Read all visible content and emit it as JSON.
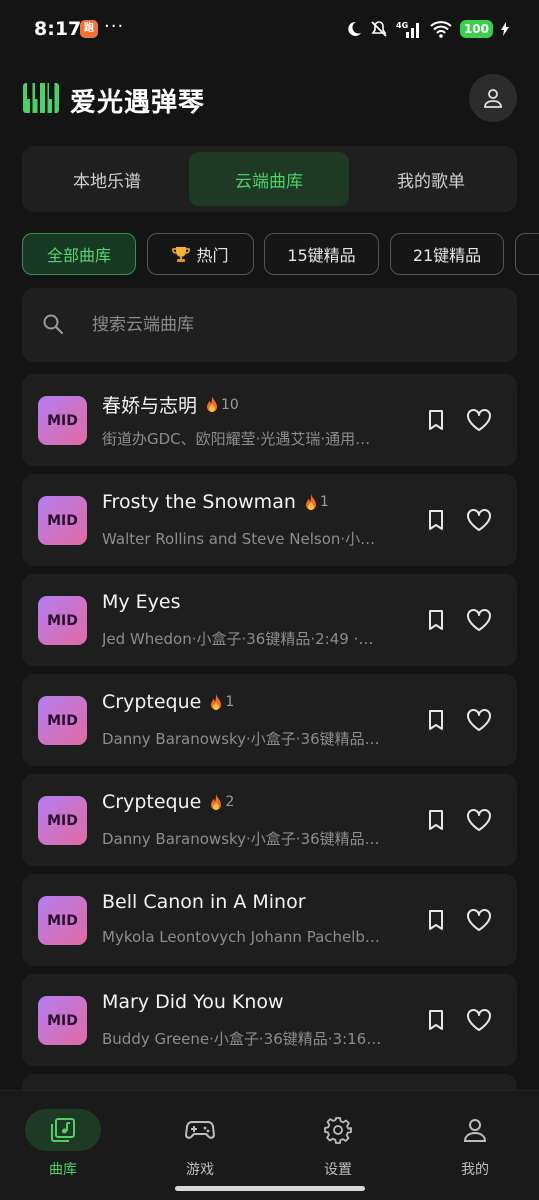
{
  "status_bar": {
    "time": "8:17",
    "app_badge": "跑",
    "dots": "···",
    "network": "4G",
    "battery": "100"
  },
  "header": {
    "title": "爱光遇弹琴",
    "brand_color": "#4fcf6a"
  },
  "segments": [
    {
      "label": "本地乐谱",
      "active": false
    },
    {
      "label": "云端曲库",
      "active": true
    },
    {
      "label": "我的歌单",
      "active": false
    }
  ],
  "chips": [
    {
      "label": "全部曲库",
      "active": true,
      "icon": ""
    },
    {
      "label": "热门",
      "active": false,
      "icon": "trophy-icon"
    },
    {
      "label": "15键精品",
      "active": false,
      "icon": ""
    },
    {
      "label": "21键精品",
      "active": false,
      "icon": ""
    },
    {
      "label": "",
      "active": false,
      "icon": ""
    }
  ],
  "search": {
    "placeholder": "搜索云端曲库",
    "value": ""
  },
  "songs": [
    {
      "badge": "MID",
      "title": "春娇与志明",
      "heat": "10",
      "meta": "街道办GDC、欧阳耀莹·光遇艾瑞·通用…"
    },
    {
      "badge": "MID",
      "title": "Frosty the Snowman",
      "heat": "1",
      "meta": "Walter Rollins and Steve Nelson·小…"
    },
    {
      "badge": "MID",
      "title": "My Eyes",
      "heat": "",
      "meta": "Jed Whedon·小盒子·36键精品·2:49 ·…"
    },
    {
      "badge": "MID",
      "title": "Crypteque",
      "heat": "1",
      "meta": "Danny Baranowsky·小盒子·36键精品…"
    },
    {
      "badge": "MID",
      "title": "Crypteque",
      "heat": "2",
      "meta": "Danny Baranowsky·小盒子·36键精品…"
    },
    {
      "badge": "MID",
      "title": "Bell Canon in A Minor",
      "heat": "",
      "meta": "Mykola Leontovych  Johann Pachelb…"
    },
    {
      "badge": "MID",
      "title": "Mary Did You Know",
      "heat": "",
      "meta": "Buddy Greene·小盒子·36键精品·3:16…"
    }
  ],
  "bottom_nav": [
    {
      "label": "曲库",
      "icon": "library-icon",
      "active": true
    },
    {
      "label": "游戏",
      "icon": "gamepad-icon",
      "active": false
    },
    {
      "label": "设置",
      "icon": "gear-icon",
      "active": false
    },
    {
      "label": "我的",
      "icon": "person-icon",
      "active": false
    }
  ]
}
